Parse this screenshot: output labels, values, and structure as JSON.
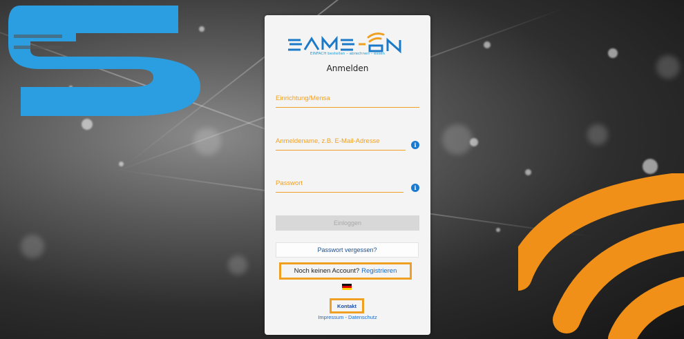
{
  "brand": {
    "name": "SAMS-ON",
    "tagline": "EINFACH bestellen – abrechnen – essen",
    "colors": {
      "blue": "#1a9ad6",
      "orange": "#f0a020"
    }
  },
  "login": {
    "title": "Anmelden",
    "facility_placeholder": "Einrichtung/Mensa",
    "username_placeholder": "Anmeldename, z.B. E-Mail-Adresse",
    "password_placeholder": "Passwort",
    "login_label": "Einloggen",
    "forgot_label": "Passwort vergessen?",
    "no_account_text": "Noch keinen Account?",
    "register_label": "Registrieren",
    "language_icon": "flag-de-icon",
    "contact_label": "Kontakt",
    "impressum_label": "Impressum",
    "footer_separator": " - ",
    "privacy_label": "Datenschutz"
  }
}
